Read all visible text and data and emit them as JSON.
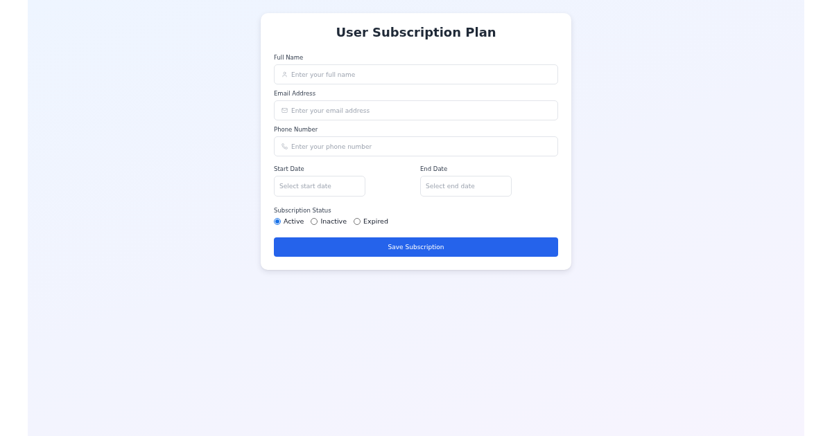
{
  "title": "User Subscription Plan",
  "fields": [
    {
      "kind": "name",
      "label": "Full Name",
      "placeholder": "Enter your full name"
    },
    {
      "kind": "email",
      "label": "Email Address",
      "placeholder": "Enter your email address"
    },
    {
      "kind": "phone",
      "label": "Phone Number",
      "placeholder": "Enter your phone number"
    }
  ],
  "dates": [
    {
      "label": "Start Date",
      "placeholder": "Select start date"
    },
    {
      "label": "End Date",
      "placeholder": "Select end date"
    }
  ],
  "status": {
    "label": "Subscription Status",
    "options": [
      {
        "label": "Active",
        "selected": true
      },
      {
        "label": "Inactive",
        "selected": false
      },
      {
        "label": "Expired",
        "selected": false
      }
    ]
  },
  "submit": "Save Subscription"
}
